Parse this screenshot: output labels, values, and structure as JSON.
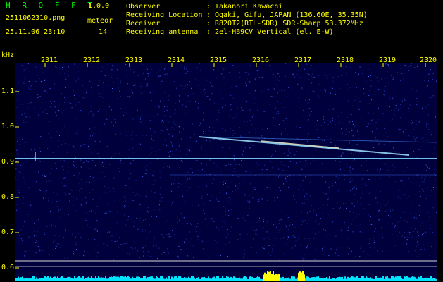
{
  "header": {
    "app_title": "H R O F F T",
    "version": "1.0.0",
    "filename": "2511062310.png",
    "datetime": "25.11.06 23:10",
    "meteor_label": "meteor",
    "meteor_count": "14"
  },
  "info": [
    {
      "key": "Observer",
      "value": "Takanori Kawachi"
    },
    {
      "key": "Receiving Location",
      "value": "Ogaki, Gifu, JAPAN (136.60E, 35.35N)"
    },
    {
      "key": "Receiver",
      "value": "R820T2(RTL-SDR) SDR-Sharp 53.372MHz"
    },
    {
      "key": "Receiving antenna",
      "value": "2el-HB9CV Vertical (el. E-W)"
    }
  ],
  "axis": {
    "y_unit": "kHz",
    "y_ticks": [
      "1.1",
      "1.0",
      "0.9",
      "0.8",
      "0.7",
      "0.6"
    ],
    "x_ticks": [
      "2311",
      "2312",
      "2313",
      "2314",
      "2315",
      "2316",
      "2317",
      "2318",
      "2319",
      "2320"
    ]
  },
  "colors": {
    "background": "#000000",
    "label": "#ffff00",
    "title": "#00ff00",
    "spectrum_bg": "#00004a",
    "carrier": "#66ccff",
    "activity": "#00ffff",
    "burst": "#ffff00"
  }
}
